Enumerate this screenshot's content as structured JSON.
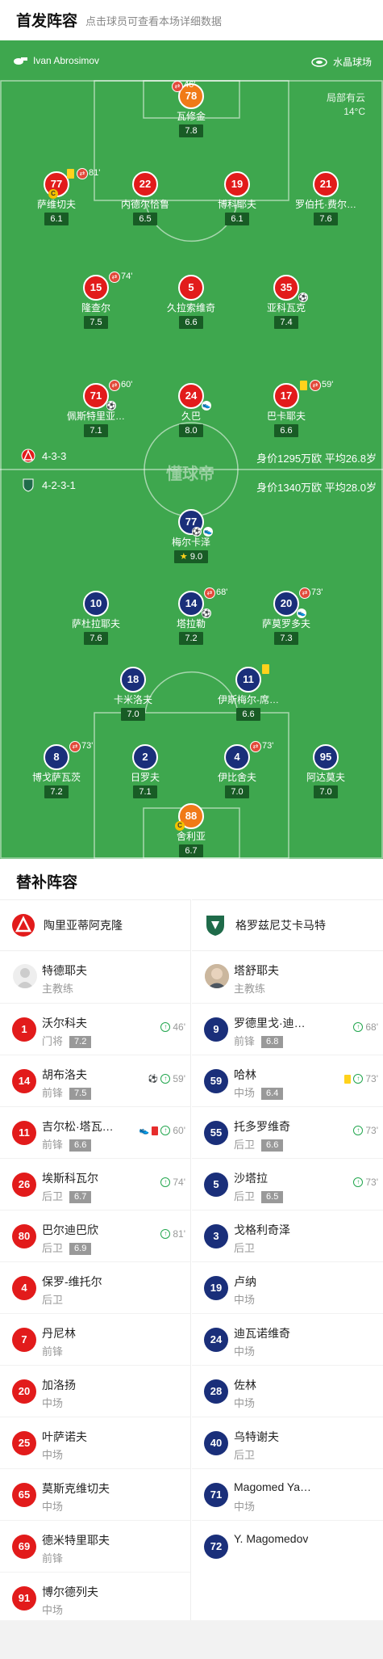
{
  "header": {
    "title": "首发阵容",
    "subtitle": "点击球员可查看本场详细数据"
  },
  "pitch": {
    "referee": "Ivan Abrosimov",
    "venue": "水晶球场",
    "weather": "局部有云",
    "temperature": "14°C",
    "home_formation": "4-3-3",
    "home_value": "身价1295万欧 平均26.8岁",
    "away_formation": "4-2-3-1",
    "away_value": "身价1340万欧 平均28.0岁",
    "watermark": "懂球帝"
  },
  "home_players": [
    {
      "num": "78",
      "name": "瓦修金",
      "rating": "7.8",
      "sub_time": "46'"
    },
    {
      "num": "77",
      "name": "萨维切夫",
      "rating": "6.1",
      "sub_time": "81'"
    },
    {
      "num": "22",
      "name": "内德尔恰鲁",
      "rating": "6.5"
    },
    {
      "num": "19",
      "name": "博科耶夫",
      "rating": "6.1"
    },
    {
      "num": "21",
      "name": "罗伯托·费尔…",
      "rating": "7.6"
    },
    {
      "num": "15",
      "name": "隆查尔",
      "rating": "7.5",
      "sub_time": "74'"
    },
    {
      "num": "5",
      "name": "久拉索维奇",
      "rating": "6.6"
    },
    {
      "num": "35",
      "name": "亚科瓦克",
      "rating": "7.4"
    },
    {
      "num": "71",
      "name": "佩斯特里亚…",
      "rating": "7.1",
      "sub_time": "60'"
    },
    {
      "num": "24",
      "name": "久巴",
      "rating": "8.0"
    },
    {
      "num": "17",
      "name": "巴卡耶夫",
      "rating": "6.6",
      "sub_time": "59'"
    }
  ],
  "away_players": [
    {
      "num": "77",
      "name": "梅尔卡泽",
      "rating": "9.0"
    },
    {
      "num": "10",
      "name": "萨杜拉耶夫",
      "rating": "7.6"
    },
    {
      "num": "14",
      "name": "塔拉勒",
      "rating": "7.2",
      "sub_time": "68'"
    },
    {
      "num": "20",
      "name": "萨莫罗多夫",
      "rating": "7.3",
      "sub_time": "73'"
    },
    {
      "num": "18",
      "name": "卡米洛夫",
      "rating": "7.0"
    },
    {
      "num": "11",
      "name": "伊斯梅尔-席…",
      "rating": "6.6"
    },
    {
      "num": "8",
      "name": "博戈萨瓦茨",
      "rating": "7.2",
      "sub_time": "73'"
    },
    {
      "num": "2",
      "name": "日罗夫",
      "rating": "7.1"
    },
    {
      "num": "4",
      "name": "伊比舍夫",
      "rating": "7.0",
      "sub_time": "73'"
    },
    {
      "num": "95",
      "name": "阿达莫夫",
      "rating": "7.0"
    },
    {
      "num": "88",
      "name": "舍利亚",
      "rating": "6.7"
    }
  ],
  "subs": {
    "title": "替补阵容",
    "home_team": "陶里亚蒂阿克隆",
    "away_team": "格罗兹尼艾卡马特",
    "home_coach": {
      "name": "特德耶夫",
      "role": "主教练"
    },
    "away_coach": {
      "name": "塔舒耶夫",
      "role": "主教练"
    },
    "home": [
      {
        "num": "1",
        "name": "沃尔科夫",
        "pos": "门将",
        "rating": "7.2",
        "time": "46'"
      },
      {
        "num": "14",
        "name": "胡布洛夫",
        "pos": "前锋",
        "rating": "7.5",
        "time": "59'"
      },
      {
        "num": "11",
        "name": "吉尔松·塔瓦…",
        "pos": "前锋",
        "rating": "6.6",
        "time": "60'"
      },
      {
        "num": "26",
        "name": "埃斯科瓦尔",
        "pos": "后卫",
        "rating": "6.7",
        "time": "74'"
      },
      {
        "num": "80",
        "name": "巴尔迪巴欣",
        "pos": "后卫",
        "rating": "6.9",
        "time": "81'"
      },
      {
        "num": "4",
        "name": "保罗-维托尔",
        "pos": "后卫"
      },
      {
        "num": "7",
        "name": "丹尼林",
        "pos": "前锋"
      },
      {
        "num": "20",
        "name": "加洛扬",
        "pos": "中场"
      },
      {
        "num": "25",
        "name": "叶萨诺夫",
        "pos": "中场"
      },
      {
        "num": "65",
        "name": "莫斯克维切夫",
        "pos": "中场"
      },
      {
        "num": "69",
        "name": "德米特里耶夫",
        "pos": "前锋"
      },
      {
        "num": "91",
        "name": "博尔德列夫",
        "pos": "中场"
      }
    ],
    "away": [
      {
        "num": "9",
        "name": "罗德里戈·迪…",
        "pos": "前锋",
        "rating": "6.8",
        "time": "68'"
      },
      {
        "num": "59",
        "name": "哈林",
        "pos": "中场",
        "rating": "6.4",
        "time": "73'"
      },
      {
        "num": "55",
        "name": "托多罗维奇",
        "pos": "后卫",
        "rating": "6.6",
        "time": "73'"
      },
      {
        "num": "5",
        "name": "沙塔拉",
        "pos": "后卫",
        "rating": "6.5",
        "time": "73'"
      },
      {
        "num": "3",
        "name": "戈格利奇泽",
        "pos": "后卫"
      },
      {
        "num": "19",
        "name": "卢纳",
        "pos": "中场"
      },
      {
        "num": "24",
        "name": "迪瓦诺维奇",
        "pos": "中场"
      },
      {
        "num": "28",
        "name": "佐林",
        "pos": "中场"
      },
      {
        "num": "40",
        "name": "乌特谢夫",
        "pos": "后卫"
      },
      {
        "num": "71",
        "name": "Magomed Ya…",
        "pos": "中场"
      },
      {
        "num": "72",
        "name": "Y. Magomedov",
        "pos": ""
      }
    ]
  },
  "colors": {
    "pitch": "#3ea74e",
    "home": "#e21b1b",
    "away": "#1a2f7a",
    "keeper": "#f07a17",
    "rating_bg": "#185c25"
  }
}
